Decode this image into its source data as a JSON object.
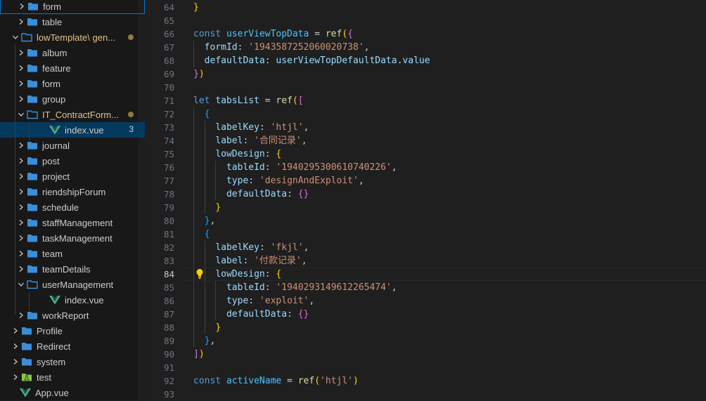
{
  "colors": {
    "folder": "#3b8ed9",
    "vue": "#41b883",
    "test_folder": "#8bc34a",
    "selected_bg": "#04395e",
    "modified": "#e2c08d"
  },
  "explorer": {
    "items": [
      {
        "label": "form",
        "type": "folder",
        "depth": 2,
        "focused": true
      },
      {
        "label": "table",
        "type": "folder",
        "depth": 2
      },
      {
        "label": "lowTemplate\\ gen...",
        "type": "folder",
        "depth": 1,
        "open": true,
        "modified": true
      },
      {
        "label": "album",
        "type": "folder",
        "depth": 2
      },
      {
        "label": "feature",
        "type": "folder",
        "depth": 2
      },
      {
        "label": "form",
        "type": "folder",
        "depth": 2
      },
      {
        "label": "group",
        "type": "folder",
        "depth": 2
      },
      {
        "label": "IT_ContractForm...",
        "type": "folder",
        "depth": 2,
        "open": true,
        "modified": true
      },
      {
        "label": "index.vue",
        "type": "vue",
        "depth": 3,
        "selected": true,
        "badge": "3"
      },
      {
        "label": "journal",
        "type": "folder",
        "depth": 2
      },
      {
        "label": "post",
        "type": "folder",
        "depth": 2
      },
      {
        "label": "project",
        "type": "folder",
        "depth": 2
      },
      {
        "label": "riendshipForum",
        "type": "folder",
        "depth": 2
      },
      {
        "label": "schedule",
        "type": "folder",
        "depth": 2
      },
      {
        "label": "staffManagement",
        "type": "folder",
        "depth": 2
      },
      {
        "label": "taskManagement",
        "type": "folder",
        "depth": 2
      },
      {
        "label": "team",
        "type": "folder",
        "depth": 2
      },
      {
        "label": "teamDetails",
        "type": "folder",
        "depth": 2
      },
      {
        "label": "userManagement",
        "type": "folder",
        "depth": 2,
        "open": true
      },
      {
        "label": "index.vue",
        "type": "vue",
        "depth": 3
      },
      {
        "label": "workReport",
        "type": "folder",
        "depth": 2
      },
      {
        "label": "Profile",
        "type": "folder",
        "depth": 1
      },
      {
        "label": "Redirect",
        "type": "folder",
        "depth": 1
      },
      {
        "label": "system",
        "type": "folder",
        "depth": 1
      },
      {
        "label": "test",
        "type": "testfolder",
        "depth": 1
      },
      {
        "label": "App.vue",
        "type": "vue",
        "depth": 0
      }
    ]
  },
  "editor": {
    "active_line": "84",
    "lines": [
      {
        "n": "64",
        "tokens": [
          [
            "b1",
            "}"
          ]
        ]
      },
      {
        "n": "65",
        "tokens": []
      },
      {
        "n": "66",
        "tokens": [
          [
            "t-kw",
            "const"
          ],
          [
            "t-p",
            " "
          ],
          [
            "t-var",
            "userViewTopData"
          ],
          [
            "t-p",
            " = "
          ],
          [
            "t-fn",
            "ref"
          ],
          [
            "b1",
            "("
          ],
          [
            "b2",
            "{"
          ]
        ]
      },
      {
        "n": "67",
        "tokens": [
          [
            "t-p",
            "  "
          ],
          [
            "t-prop",
            "formId"
          ],
          [
            "t-p",
            ": "
          ],
          [
            "t-str",
            "'1943587252060020738'"
          ],
          [
            "t-p",
            ","
          ]
        ]
      },
      {
        "n": "68",
        "tokens": [
          [
            "t-p",
            "  "
          ],
          [
            "t-prop",
            "defaultData"
          ],
          [
            "t-p",
            ": "
          ],
          [
            "t-prop",
            "userViewTopDefaultData"
          ],
          [
            "t-p",
            "."
          ],
          [
            "t-prop",
            "value"
          ]
        ]
      },
      {
        "n": "69",
        "tokens": [
          [
            "b2",
            "}"
          ],
          [
            "b1",
            ")"
          ]
        ]
      },
      {
        "n": "70",
        "tokens": []
      },
      {
        "n": "71",
        "tokens": [
          [
            "t-kw",
            "let"
          ],
          [
            "t-p",
            " "
          ],
          [
            "t-prop",
            "tabsList"
          ],
          [
            "t-p",
            " = "
          ],
          [
            "t-fn",
            "ref"
          ],
          [
            "b1",
            "("
          ],
          [
            "b2",
            "["
          ]
        ]
      },
      {
        "n": "72",
        "tokens": [
          [
            "t-p",
            "  "
          ],
          [
            "b3",
            "{"
          ]
        ]
      },
      {
        "n": "73",
        "tokens": [
          [
            "t-p",
            "    "
          ],
          [
            "t-prop",
            "labelKey"
          ],
          [
            "t-p",
            ": "
          ],
          [
            "t-str",
            "'htjl'"
          ],
          [
            "t-p",
            ","
          ]
        ]
      },
      {
        "n": "74",
        "tokens": [
          [
            "t-p",
            "    "
          ],
          [
            "t-prop",
            "label"
          ],
          [
            "t-p",
            ": "
          ],
          [
            "t-str",
            "'合同记录'"
          ],
          [
            "t-p",
            ","
          ]
        ]
      },
      {
        "n": "75",
        "tokens": [
          [
            "t-p",
            "    "
          ],
          [
            "t-prop",
            "lowDesign"
          ],
          [
            "t-p",
            ": "
          ],
          [
            "b1",
            "{"
          ]
        ]
      },
      {
        "n": "76",
        "tokens": [
          [
            "t-p",
            "      "
          ],
          [
            "t-prop",
            "tableId"
          ],
          [
            "t-p",
            ": "
          ],
          [
            "t-str",
            "'1940295300610740226'"
          ],
          [
            "t-p",
            ","
          ]
        ]
      },
      {
        "n": "77",
        "tokens": [
          [
            "t-p",
            "      "
          ],
          [
            "t-prop",
            "type"
          ],
          [
            "t-p",
            ": "
          ],
          [
            "t-str",
            "'designAndExploit'"
          ],
          [
            "t-p",
            ","
          ]
        ]
      },
      {
        "n": "78",
        "tokens": [
          [
            "t-p",
            "      "
          ],
          [
            "t-prop",
            "defaultData"
          ],
          [
            "t-p",
            ": "
          ],
          [
            "b2",
            "{}"
          ]
        ]
      },
      {
        "n": "79",
        "tokens": [
          [
            "t-p",
            "    "
          ],
          [
            "b1",
            "}"
          ]
        ]
      },
      {
        "n": "80",
        "tokens": [
          [
            "t-p",
            "  "
          ],
          [
            "b3",
            "}"
          ],
          [
            "t-p",
            ","
          ]
        ]
      },
      {
        "n": "81",
        "tokens": [
          [
            "t-p",
            "  "
          ],
          [
            "b3",
            "{"
          ]
        ]
      },
      {
        "n": "82",
        "tokens": [
          [
            "t-p",
            "    "
          ],
          [
            "t-prop",
            "labelKey"
          ],
          [
            "t-p",
            ": "
          ],
          [
            "t-str",
            "'fkjl'"
          ],
          [
            "t-p",
            ","
          ]
        ]
      },
      {
        "n": "83",
        "tokens": [
          [
            "t-p",
            "    "
          ],
          [
            "t-prop",
            "label"
          ],
          [
            "t-p",
            ": "
          ],
          [
            "t-str",
            "'付款记录'"
          ],
          [
            "t-p",
            ","
          ]
        ]
      },
      {
        "n": "84",
        "tokens": [
          [
            "t-p",
            "    "
          ],
          [
            "t-prop",
            "lowDesign"
          ],
          [
            "t-p",
            ": "
          ],
          [
            "b1",
            "{"
          ]
        ]
      },
      {
        "n": "85",
        "tokens": [
          [
            "t-p",
            "      "
          ],
          [
            "t-prop",
            "tableId"
          ],
          [
            "t-p",
            ": "
          ],
          [
            "t-str",
            "'1940293149612265474'"
          ],
          [
            "t-p",
            ","
          ]
        ]
      },
      {
        "n": "86",
        "tokens": [
          [
            "t-p",
            "      "
          ],
          [
            "t-prop",
            "type"
          ],
          [
            "t-p",
            ": "
          ],
          [
            "t-str",
            "'exploit'"
          ],
          [
            "t-p",
            ","
          ]
        ]
      },
      {
        "n": "87",
        "tokens": [
          [
            "t-p",
            "      "
          ],
          [
            "t-prop",
            "defaultData"
          ],
          [
            "t-p",
            ": "
          ],
          [
            "b2",
            "{}"
          ]
        ]
      },
      {
        "n": "88",
        "tokens": [
          [
            "t-p",
            "    "
          ],
          [
            "b1",
            "}"
          ]
        ]
      },
      {
        "n": "89",
        "tokens": [
          [
            "t-p",
            "  "
          ],
          [
            "b3",
            "}"
          ],
          [
            "t-p",
            ","
          ]
        ]
      },
      {
        "n": "90",
        "tokens": [
          [
            "b2",
            "]"
          ],
          [
            "b1",
            ")"
          ]
        ]
      },
      {
        "n": "91",
        "tokens": []
      },
      {
        "n": "92",
        "tokens": [
          [
            "t-kw",
            "const"
          ],
          [
            "t-p",
            " "
          ],
          [
            "t-var",
            "activeName"
          ],
          [
            "t-p",
            " = "
          ],
          [
            "t-fn",
            "ref"
          ],
          [
            "b1",
            "("
          ],
          [
            "t-str",
            "'htjl'"
          ],
          [
            "b1",
            ")"
          ]
        ]
      },
      {
        "n": "93",
        "tokens": []
      }
    ]
  }
}
